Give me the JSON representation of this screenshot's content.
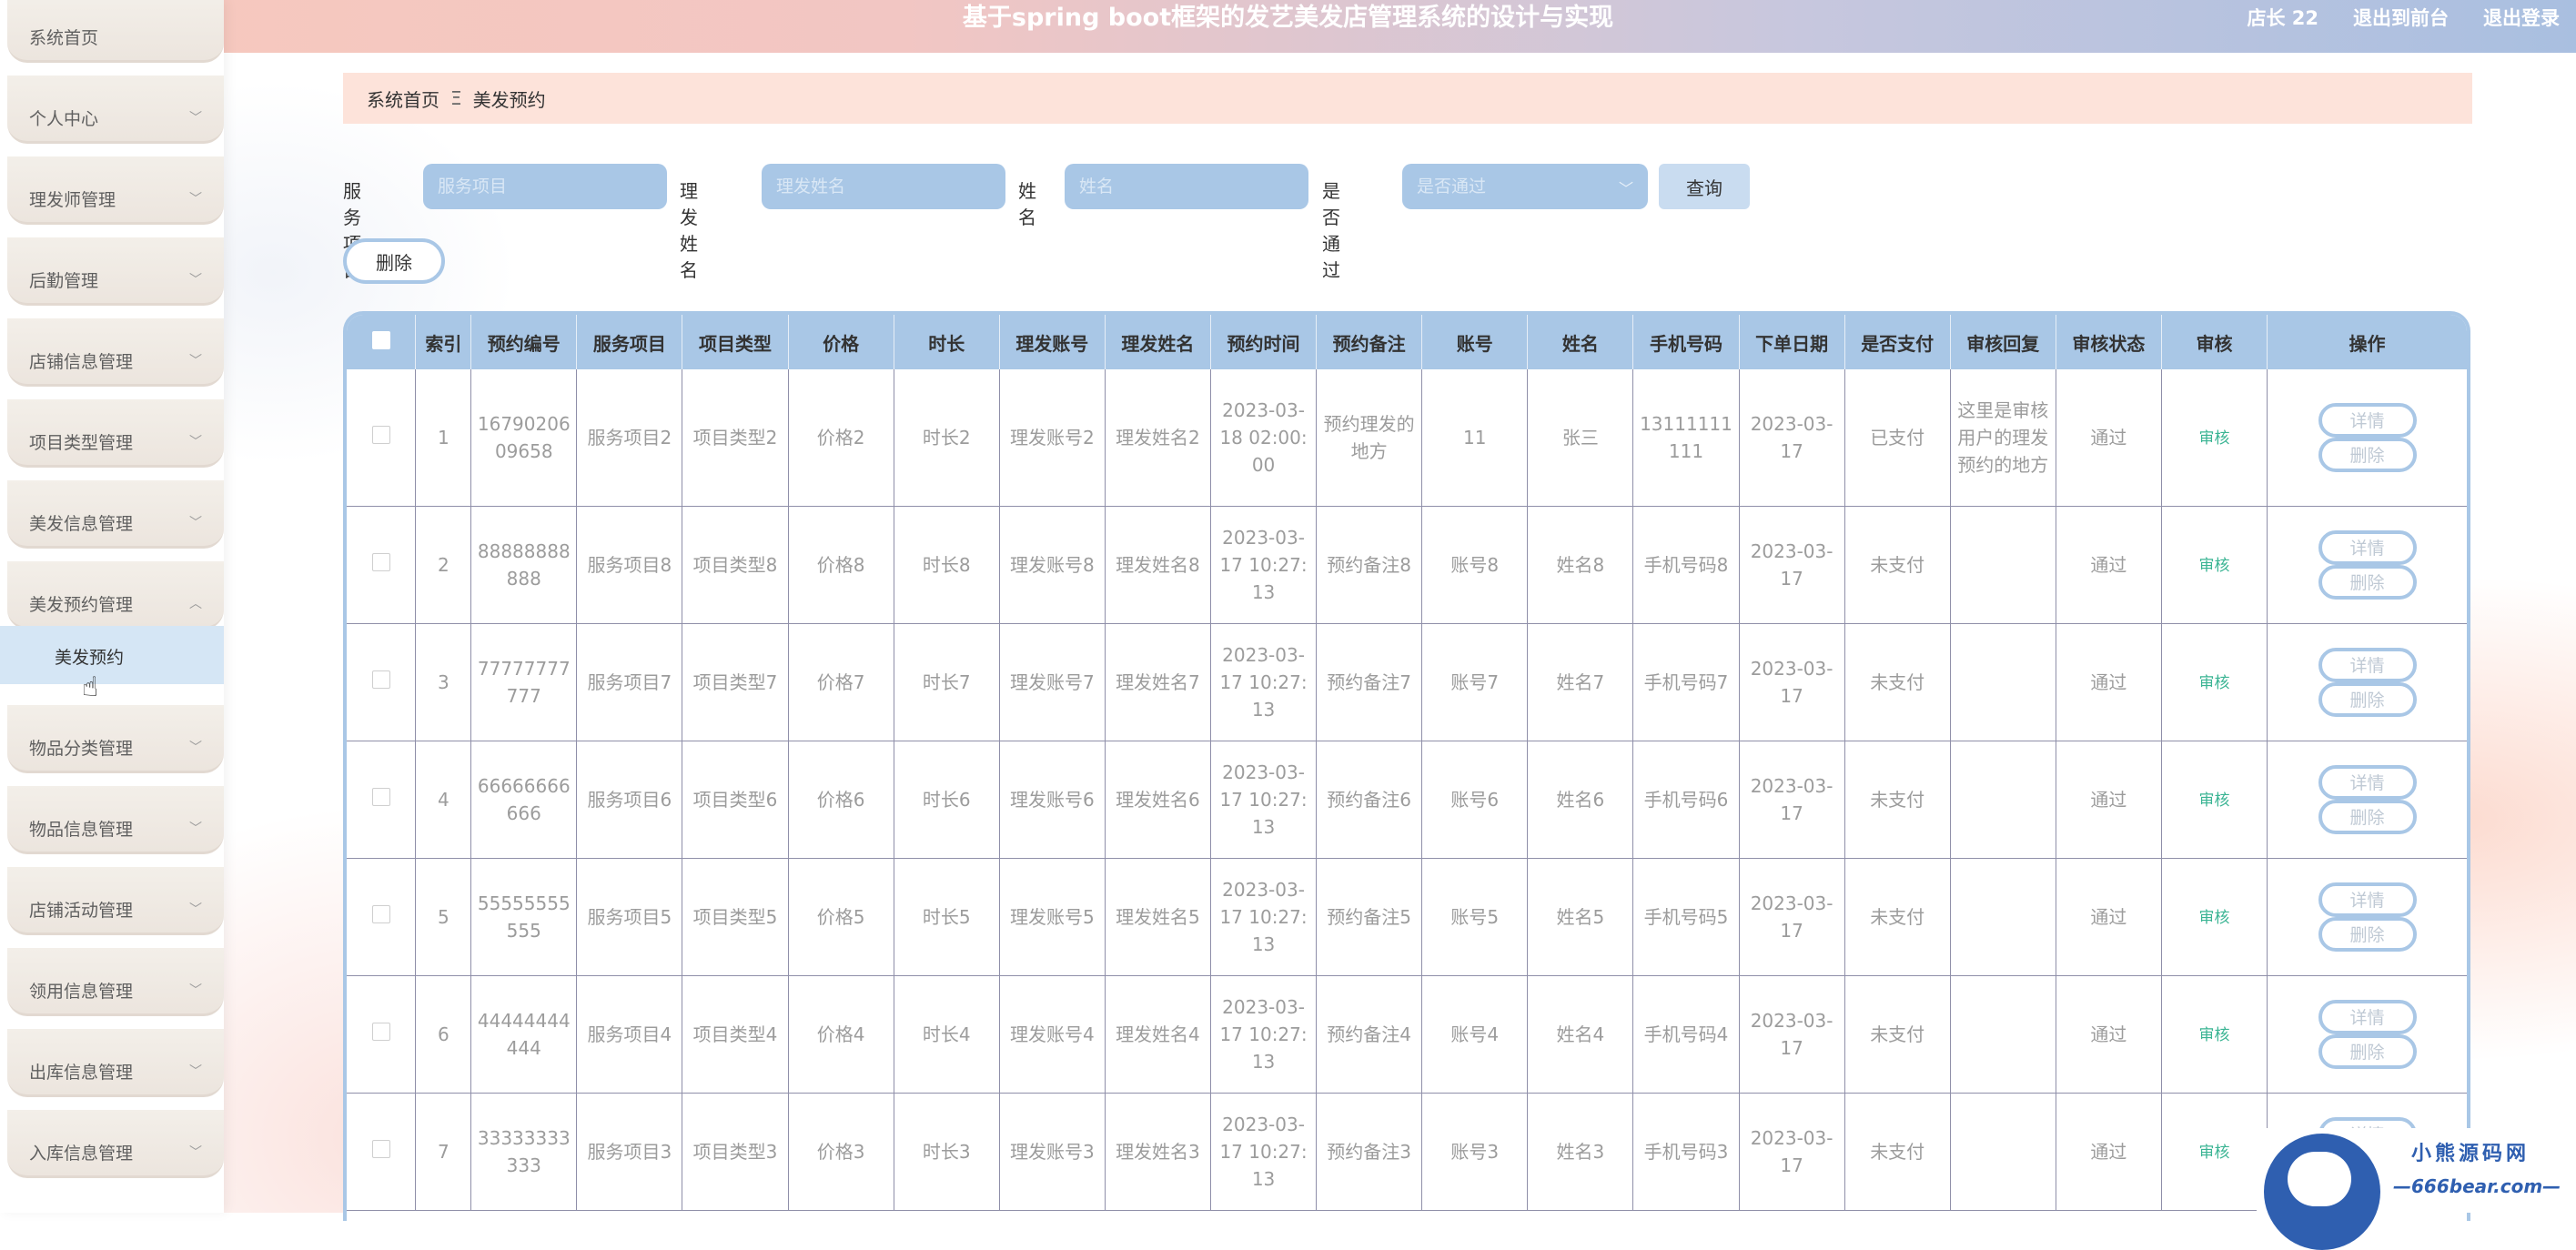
{
  "app": {
    "title": "基于spring boot框架的发艺美发店管理系统的设计与实现",
    "user": "店长 22",
    "back_link": "退出到前台",
    "logout_link": "退出登录"
  },
  "sidebar": {
    "items": [
      {
        "label": "系统首页",
        "chevron": ""
      },
      {
        "label": "个人中心",
        "chevron": "﹀"
      },
      {
        "label": "理发师管理",
        "chevron": "﹀"
      },
      {
        "label": "后勤管理",
        "chevron": "﹀"
      },
      {
        "label": "店铺信息管理",
        "chevron": "﹀"
      },
      {
        "label": "项目类型管理",
        "chevron": "﹀"
      },
      {
        "label": "美发信息管理",
        "chevron": "﹀"
      },
      {
        "label": "美发预约管理",
        "chevron": "︿"
      },
      {
        "label": "物品分类管理",
        "chevron": "﹀"
      },
      {
        "label": "物品信息管理",
        "chevron": "﹀"
      },
      {
        "label": "店铺活动管理",
        "chevron": "﹀"
      },
      {
        "label": "领用信息管理",
        "chevron": "﹀"
      },
      {
        "label": "出库信息管理",
        "chevron": "﹀"
      },
      {
        "label": "入库信息管理",
        "chevron": "﹀"
      }
    ],
    "active_sub": "美发预约"
  },
  "breadcrumb": {
    "home": "系统首页",
    "separator": "Ξ",
    "current": "美发预约"
  },
  "search": {
    "service_label": "服务项目",
    "service_placeholder": "服务项目",
    "barber_label": "理发姓名",
    "barber_placeholder": "理发姓名",
    "name_label": "姓名",
    "name_placeholder": "姓名",
    "pass_label": "是否通过",
    "pass_placeholder": "是否通过",
    "query_label": "查询"
  },
  "toolbar": {
    "delete_label": "删除"
  },
  "table": {
    "headers": [
      "索引",
      "预约编号",
      "服务项目",
      "项目类型",
      "价格",
      "时长",
      "理发账号",
      "理发姓名",
      "预约时间",
      "预约备注",
      "账号",
      "姓名",
      "手机号码",
      "下单日期",
      "是否支付",
      "审核回复",
      "审核状态",
      "审核",
      "操作"
    ],
    "audit_link": "审核",
    "detail_label": "详情",
    "delete_label": "删除",
    "rows": [
      {
        "index": "1",
        "order_no": "1679020609658",
        "service": "服务项目2",
        "type": "项目类型2",
        "price": "价格2",
        "duration": "时长2",
        "barber_account": "理发账号2",
        "barber_name": "理发姓名2",
        "time": "2023-03-18 02:00:00",
        "remark": "预约理发的地方",
        "account": "11",
        "name": "张三",
        "phone": "13111111111",
        "date": "2023-03-17",
        "paid": "已支付",
        "reply": "这里是审核用户的理发预约的地方",
        "status": "通过"
      },
      {
        "index": "2",
        "order_no": "88888888888",
        "service": "服务项目8",
        "type": "项目类型8",
        "price": "价格8",
        "duration": "时长8",
        "barber_account": "理发账号8",
        "barber_name": "理发姓名8",
        "time": "2023-03-17 10:27:13",
        "remark": "预约备注8",
        "account": "账号8",
        "name": "姓名8",
        "phone": "手机号码8",
        "date": "2023-03-17",
        "paid": "未支付",
        "reply": "",
        "status": "通过"
      },
      {
        "index": "3",
        "order_no": "77777777777",
        "service": "服务项目7",
        "type": "项目类型7",
        "price": "价格7",
        "duration": "时长7",
        "barber_account": "理发账号7",
        "barber_name": "理发姓名7",
        "time": "2023-03-17 10:27:13",
        "remark": "预约备注7",
        "account": "账号7",
        "name": "姓名7",
        "phone": "手机号码7",
        "date": "2023-03-17",
        "paid": "未支付",
        "reply": "",
        "status": "通过"
      },
      {
        "index": "4",
        "order_no": "66666666666",
        "service": "服务项目6",
        "type": "项目类型6",
        "price": "价格6",
        "duration": "时长6",
        "barber_account": "理发账号6",
        "barber_name": "理发姓名6",
        "time": "2023-03-17 10:27:13",
        "remark": "预约备注6",
        "account": "账号6",
        "name": "姓名6",
        "phone": "手机号码6",
        "date": "2023-03-17",
        "paid": "未支付",
        "reply": "",
        "status": "通过"
      },
      {
        "index": "5",
        "order_no": "55555555555",
        "service": "服务项目5",
        "type": "项目类型5",
        "price": "价格5",
        "duration": "时长5",
        "barber_account": "理发账号5",
        "barber_name": "理发姓名5",
        "time": "2023-03-17 10:27:13",
        "remark": "预约备注5",
        "account": "账号5",
        "name": "姓名5",
        "phone": "手机号码5",
        "date": "2023-03-17",
        "paid": "未支付",
        "reply": "",
        "status": "通过"
      },
      {
        "index": "6",
        "order_no": "44444444444",
        "service": "服务项目4",
        "type": "项目类型4",
        "price": "价格4",
        "duration": "时长4",
        "barber_account": "理发账号4",
        "barber_name": "理发姓名4",
        "time": "2023-03-17 10:27:13",
        "remark": "预约备注4",
        "account": "账号4",
        "name": "姓名4",
        "phone": "手机号码4",
        "date": "2023-03-17",
        "paid": "未支付",
        "reply": "",
        "status": "通过"
      },
      {
        "index": "7",
        "order_no": "33333333333",
        "service": "服务项目3",
        "type": "项目类型3",
        "price": "价格3",
        "duration": "时长3",
        "barber_account": "理发账号3",
        "barber_name": "理发姓名3",
        "time": "2023-03-17 10:27:13",
        "remark": "预约备注3",
        "account": "账号3",
        "name": "姓名3",
        "phone": "手机号码3",
        "date": "2023-03-17",
        "paid": "未支付",
        "reply": "",
        "status": "通过"
      }
    ]
  },
  "watermark": {
    "line1": "小熊源码网",
    "line2": "—666bear.com—"
  },
  "colors": {
    "accent": "#a9c7e6",
    "header_bg": "#f7c9bd",
    "audit_link": "#3ab493"
  }
}
